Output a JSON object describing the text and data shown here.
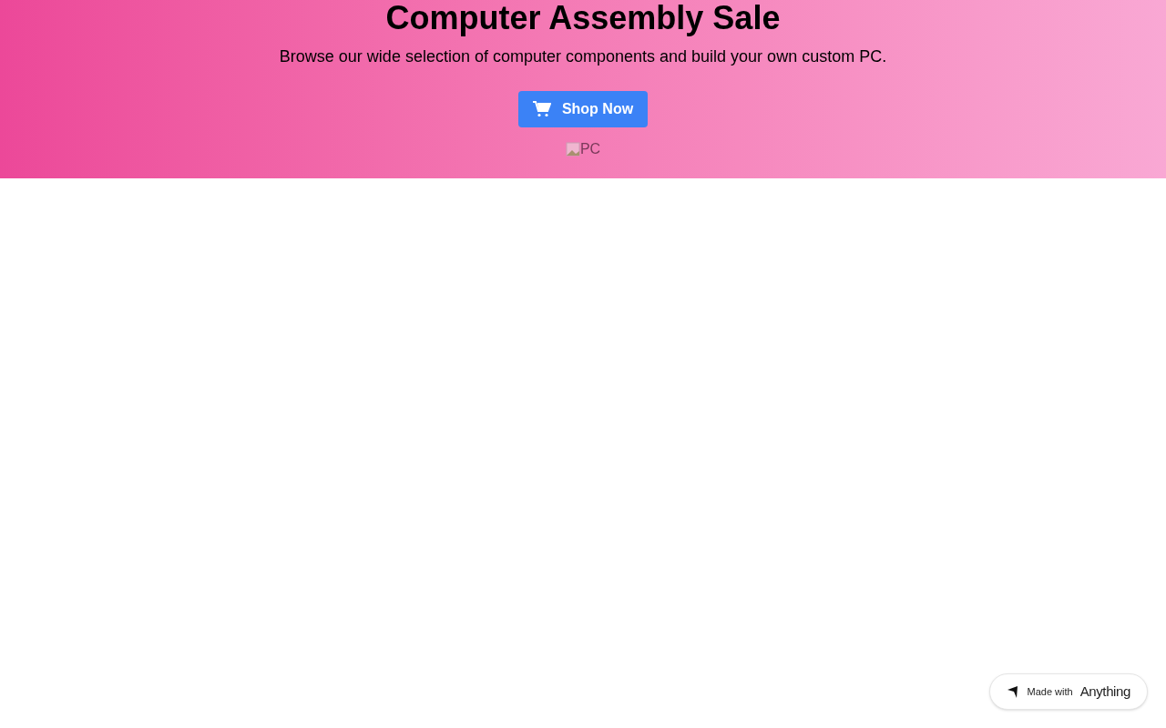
{
  "hero": {
    "title": "Computer Assembly Sale",
    "subtitle": "Browse our wide selection of computer components and build your own custom PC.",
    "button": "Shop Now",
    "image_alt": "PC"
  },
  "badge": {
    "text": "Made with",
    "brand": "Anything"
  }
}
